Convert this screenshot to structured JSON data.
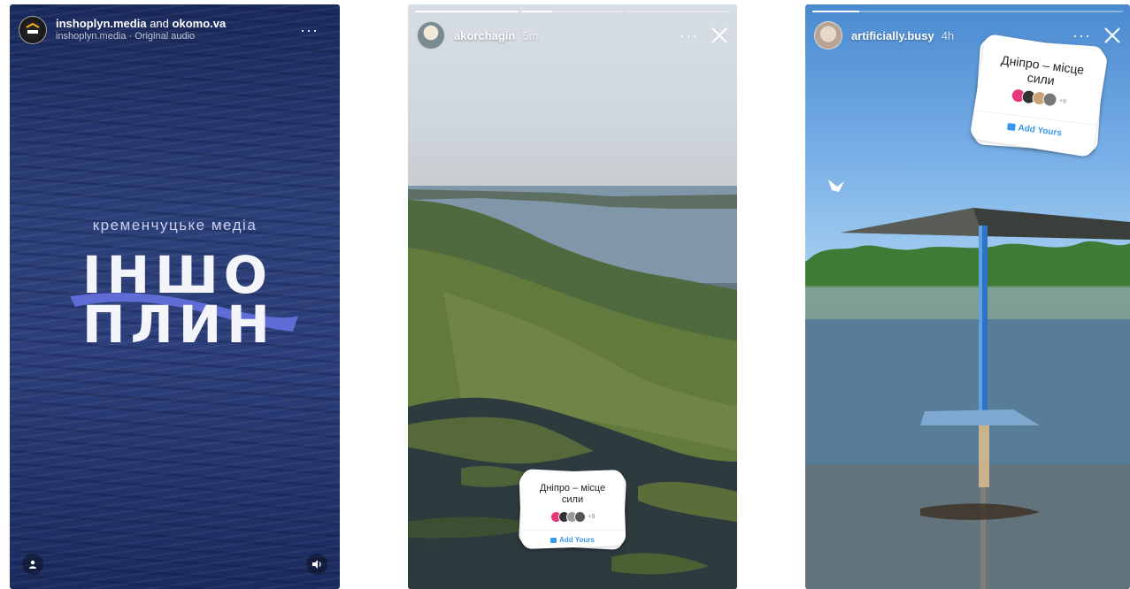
{
  "stories": [
    {
      "header": {
        "account": "inshoplyn.media",
        "connector": "and",
        "collab": "okomo.va",
        "audio": "inshoplyn.media · Original audio"
      },
      "content": {
        "tagline": "кременчуцьке медіа",
        "logo_line1": "ІНШО",
        "logo_line2": "ПЛИН",
        "avatar_badge": "ІНШО"
      },
      "icons": [
        "more-icon",
        "person-icon",
        "speaker-icon"
      ]
    },
    {
      "header": {
        "username": "akorchagin",
        "time": "5m"
      },
      "progress": [
        1.0,
        0.3,
        0.0
      ],
      "sticker": {
        "prompt": "Дніпро – місце сили",
        "extra_count": "+9",
        "action": "Add Yours"
      },
      "icons": [
        "more-icon",
        "close-icon"
      ]
    },
    {
      "header": {
        "username": "artificially.busy",
        "time": "4h"
      },
      "progress": [
        0.15
      ],
      "sticker": {
        "prompt": "Дніпро – місце сили",
        "extra_count": "+9",
        "action": "Add Yours"
      },
      "icons": [
        "more-icon",
        "close-icon"
      ]
    }
  ],
  "colors": {
    "ig_blue": "#3897f0",
    "logo_streak": "#6a74e6"
  }
}
